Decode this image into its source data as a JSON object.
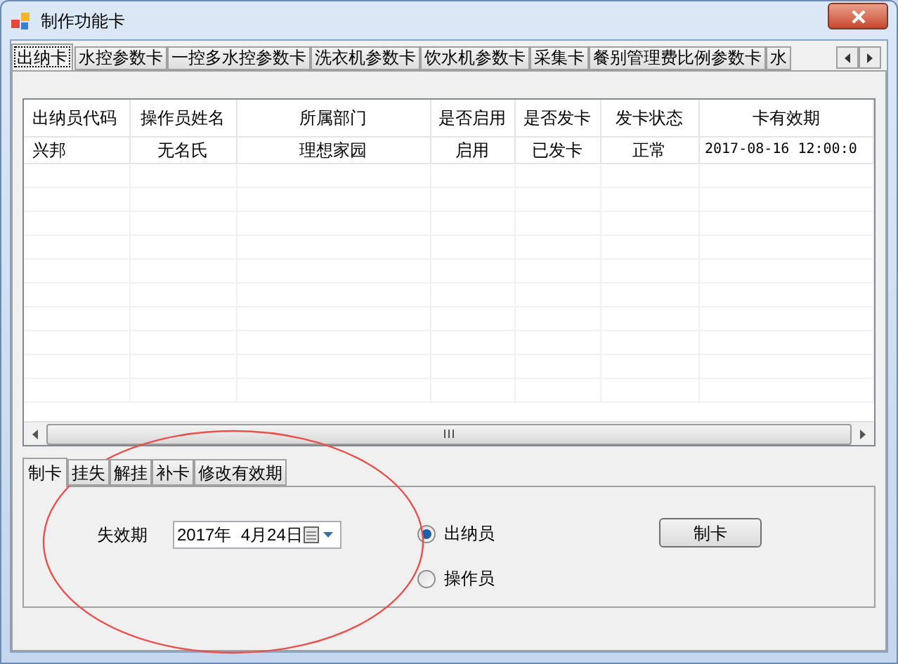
{
  "window": {
    "title": "制作功能卡"
  },
  "tabs": [
    {
      "label": "出纳卡",
      "selected": true
    },
    {
      "label": "水控参数卡",
      "selected": false
    },
    {
      "label": "一控多水控参数卡",
      "selected": false
    },
    {
      "label": "洗衣机参数卡",
      "selected": false
    },
    {
      "label": "饮水机参数卡",
      "selected": false
    },
    {
      "label": "采集卡",
      "selected": false
    },
    {
      "label": "餐别管理费比例参数卡",
      "selected": false
    },
    {
      "label": "水",
      "selected": false
    }
  ],
  "table": {
    "columns": [
      "出纳员代码",
      "操作员姓名",
      "所属部门",
      "是否启用",
      "是否发卡",
      "发卡状态",
      "卡有效期"
    ],
    "rows": [
      {
        "cells": [
          "兴邦",
          "无名氏",
          "理想家园",
          "启用",
          "已发卡",
          "正常",
          "2017-08-16 12:00:0"
        ]
      }
    ]
  },
  "sub_tabs": [
    {
      "label": "制卡",
      "selected": true
    },
    {
      "label": "挂失",
      "selected": false
    },
    {
      "label": "解挂",
      "selected": false
    },
    {
      "label": "补卡",
      "selected": false
    },
    {
      "label": "修改有效期",
      "selected": false
    }
  ],
  "form": {
    "expiry_label": "失效期",
    "expiry_date": "2017年  4月24日",
    "roles": [
      {
        "label": "出纳员",
        "selected": true
      },
      {
        "label": "操作员",
        "selected": false
      }
    ],
    "make_button": "制卡"
  }
}
